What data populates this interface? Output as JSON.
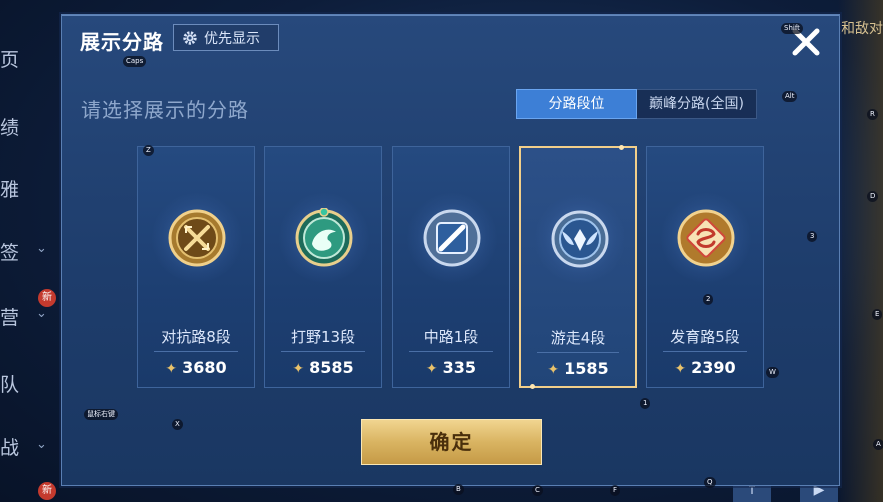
{
  "modal": {
    "title": "展示分路",
    "priority_button": "优先显示",
    "subtitle": "请选择展示的分路",
    "tabs": [
      {
        "label": "分路段位",
        "active": true
      },
      {
        "label": "巅峰分路(全国)",
        "active": false
      }
    ],
    "lanes": [
      {
        "name": "对抗路8段",
        "score": "3680",
        "icon": "clash-lane-emblem",
        "selected": false
      },
      {
        "name": "打野13段",
        "score": "8585",
        "icon": "jungle-dragon-emblem",
        "selected": false
      },
      {
        "name": "中路1段",
        "score": "335",
        "icon": "mid-lane-emblem",
        "selected": false
      },
      {
        "name": "游走4段",
        "score": "1585",
        "icon": "roam-wings-emblem",
        "selected": true
      },
      {
        "name": "发育路5段",
        "score": "2390",
        "icon": "farm-lane-emblem",
        "selected": false
      }
    ],
    "confirm_label": "确定",
    "colors": {
      "accent_gold": "#f2cf8a",
      "tab_active": "#3d7fd6",
      "panel": "#27497c"
    }
  },
  "background": {
    "nav_glyphs": [
      "页",
      "绩",
      "雅",
      "签",
      "营",
      "队",
      "战"
    ],
    "new_badge": "新",
    "right_text": "雄和敌对"
  },
  "key_hints": {
    "shift": "Shift",
    "caps": "Caps",
    "alt": "Alt",
    "r": "R",
    "d": "D",
    "z": "Z",
    "three": "3",
    "two": "2",
    "e": "E",
    "w": "W",
    "one": "1",
    "x": "X",
    "a": "A",
    "q": "Q",
    "b": "B",
    "c": "C",
    "f": "F",
    "mouse": "鼠标右键"
  }
}
